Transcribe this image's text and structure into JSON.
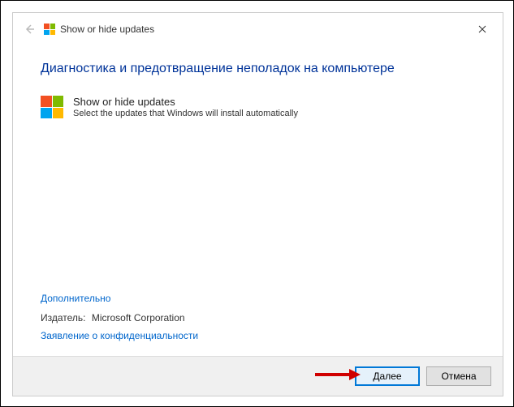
{
  "titlebar": {
    "title": "Show or hide updates"
  },
  "content": {
    "heading": "Диагностика и предотвращение неполадок на компьютере",
    "item": {
      "title": "Show or hide updates",
      "subtitle": "Select the updates that Windows will install automatically"
    },
    "advanced_link": "Дополнительно",
    "publisher_label": "Издатель:",
    "publisher_value": "Microsoft Corporation",
    "privacy_link": "Заявление о конфиденциальности"
  },
  "footer": {
    "next": "Далее",
    "cancel": "Отмена"
  }
}
